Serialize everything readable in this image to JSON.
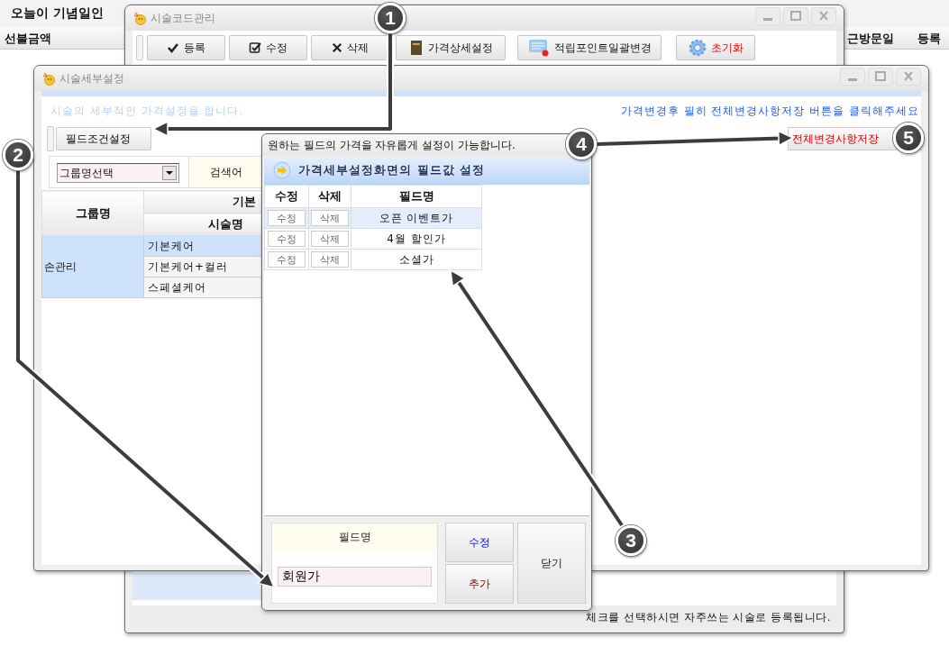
{
  "background_app": {
    "marquee": "오늘이 기념일인",
    "columns": [
      "선불금액",
      "근방문일",
      "등록"
    ]
  },
  "code_window": {
    "title": "시술코드관리",
    "toolbar": [
      {
        "label": "등록",
        "kind": "normal"
      },
      {
        "label": "수정",
        "kind": "normal"
      },
      {
        "label": "삭제",
        "kind": "normal"
      },
      {
        "label": "가격상세설정",
        "kind": "normal"
      },
      {
        "label": "적립포인트일괄변경",
        "kind": "normal"
      },
      {
        "label": "초기화",
        "kind": "danger"
      }
    ],
    "status": "체크를 선택하시면 자주쓰는 시술로 등록됩니다."
  },
  "detail_window": {
    "title": "시술세부설정",
    "description": "시술의 세부적인 가격설정을 합니다.",
    "notice": "가격변경후 필히 전체변경사항저장 버튼을 클릭해주세요",
    "field_button": "필드조건설정",
    "save_button": "전체변경사항저장",
    "group_select": "그룹명선택",
    "search_label": "검색어",
    "table": {
      "group_header": "그룹명",
      "top_header": "기본",
      "sub_header": "시술명",
      "groups": [
        {
          "name": "손관리",
          "items": [
            {
              "name": "기본케어",
              "selected": true
            },
            {
              "name": "기본케어+컬러",
              "selected": false
            },
            {
              "name": "스페셜케어",
              "selected": false
            }
          ]
        }
      ]
    }
  },
  "field_dialog": {
    "hint": "원하는 필드의 가격을 자유롭게 설정이 가능합니다.",
    "heading": "가격세부설정화면의 필드값 설정",
    "columns": [
      "수정",
      "삭제",
      "필드명"
    ],
    "rows": [
      {
        "edit": "수정",
        "delete": "삭제",
        "name": "오픈 이벤트가",
        "selected": true
      },
      {
        "edit": "수정",
        "delete": "삭제",
        "name": "4월 할인가",
        "selected": false
      },
      {
        "edit": "수정",
        "delete": "삭제",
        "name": "소셜가",
        "selected": false
      }
    ],
    "form_label": "필드명",
    "form_value": "회원가",
    "buttons": [
      {
        "label": "수정",
        "kind": "edit"
      },
      {
        "label": "추가",
        "kind": "add"
      },
      {
        "label": "닫기",
        "kind": "close"
      }
    ]
  },
  "callouts": [
    "1",
    "2",
    "3",
    "4",
    "5"
  ]
}
